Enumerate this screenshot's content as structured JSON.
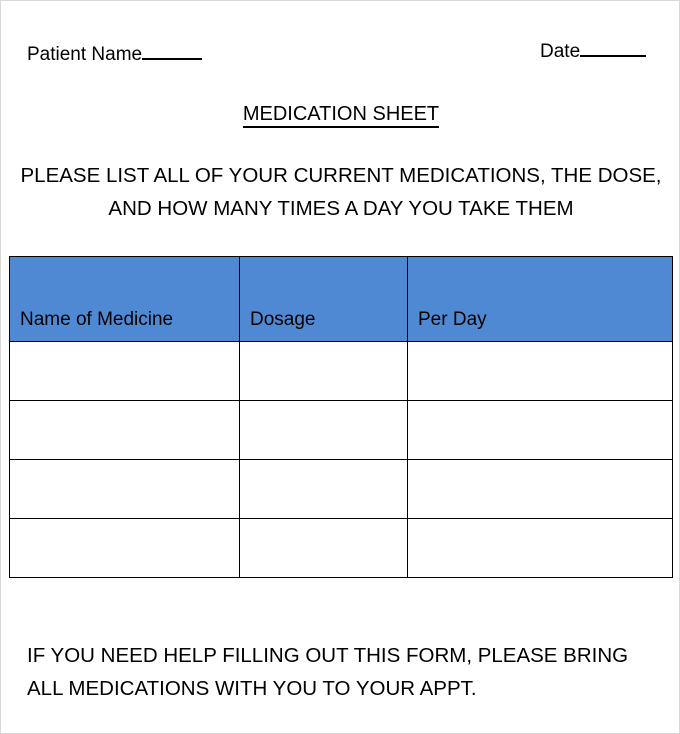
{
  "document": {
    "title": "MEDICATION SHEET",
    "header_fields": {
      "patient_name_label": "Patient Name",
      "patient_name_value": "",
      "date_label": "Date",
      "date_value": ""
    },
    "instructions": {
      "line1": "PLEASE LIST ALL OF YOUR CURRENT MEDICATIONS, THE",
      "line2": "DOSE, AND HOW MANY TIMES A DAY YOU TAKE THEM"
    },
    "table": {
      "columns": [
        "Name of Medicine",
        "Dosage",
        "Per Day"
      ],
      "rows": [
        [
          "",
          "",
          ""
        ],
        [
          "",
          "",
          ""
        ],
        [
          "",
          "",
          ""
        ],
        [
          "",
          "",
          ""
        ]
      ],
      "header_background": "#5089d3",
      "border_color": "#000000"
    },
    "footer_note": {
      "line1": "IF YOU NEED HELP FILLING OUT THIS FORM, PLEASE BRING",
      "line2": "ALL MEDICATIONS WITH YOU TO YOUR APPT."
    }
  }
}
